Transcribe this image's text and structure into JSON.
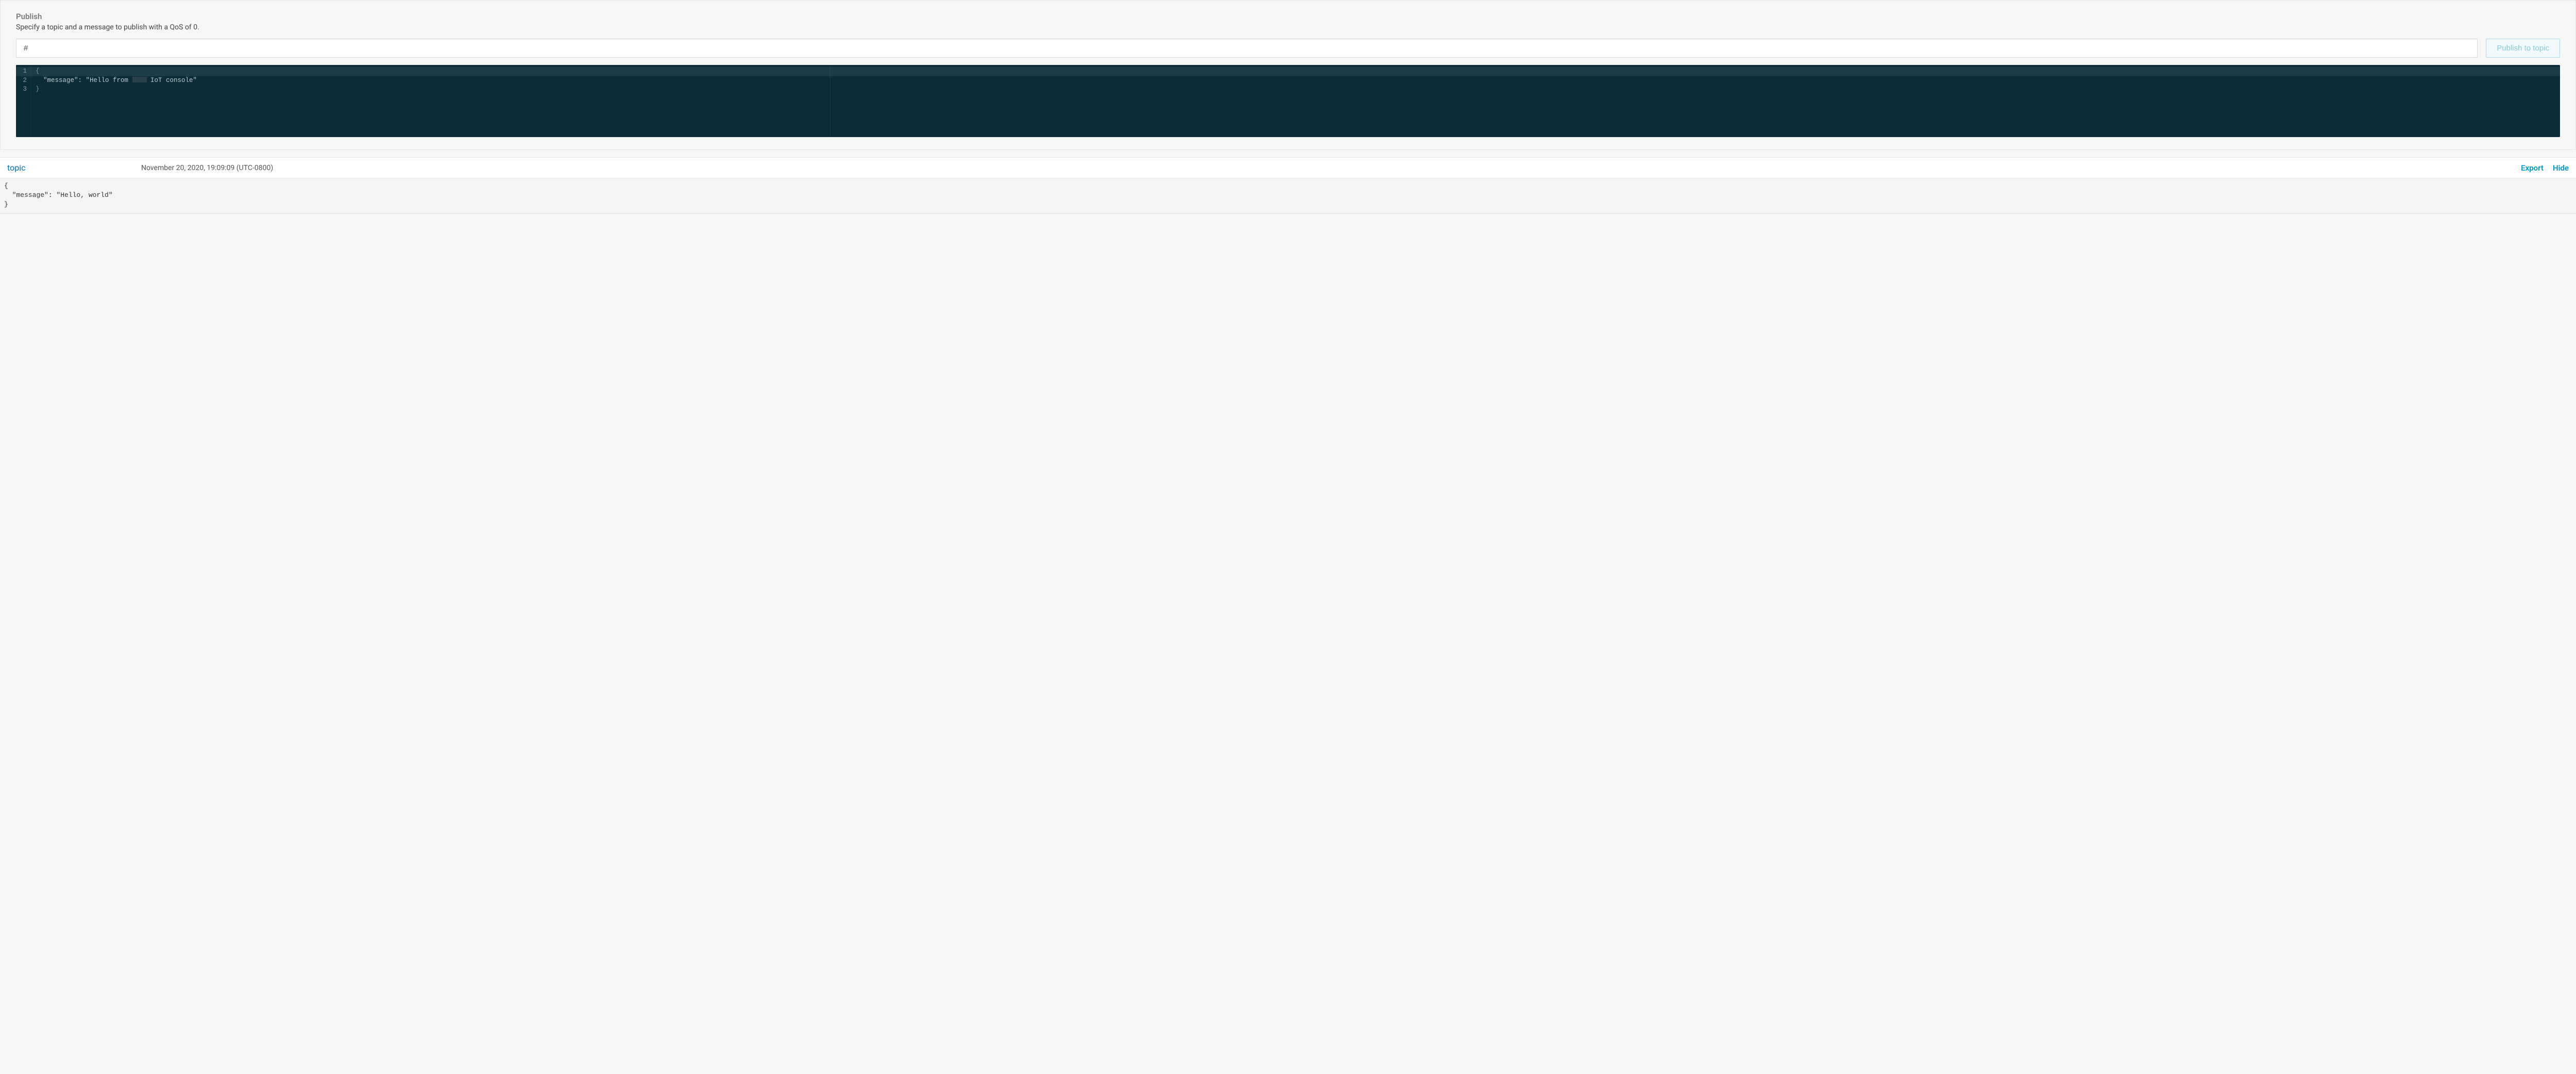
{
  "publish": {
    "title": "Publish",
    "subtitle": "Specify a topic and a message to publish with a QoS of 0.",
    "topic_value": "#",
    "button_label": "Publish to topic",
    "editor_lines": [
      "1",
      "2",
      "3"
    ],
    "code_line1_open": "{",
    "code_line2_pre": "  \"message\": \"Hello from ",
    "code_line2_post": " IoT console\"",
    "code_line3_close": "}"
  },
  "message": {
    "topic_label": "topic",
    "timestamp": "November 20, 2020, 19:09:09 (UTC-0800)",
    "export_label": "Export",
    "hide_label": "Hide",
    "body": "{\n  \"message\": \"Hello, world\"\n}"
  }
}
